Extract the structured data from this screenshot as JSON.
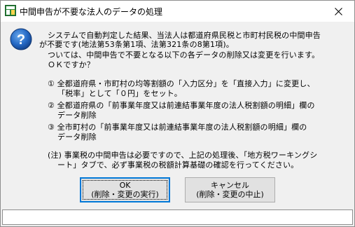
{
  "window": {
    "title": "中間申告が不要な法人のデータの処理"
  },
  "icons": {
    "app": "app-icon",
    "dialog": "question-icon",
    "close": "close-icon"
  },
  "message": {
    "lines": [
      "システムで自動判定した結果、当法人は都道府県民税と市町村民税の中間申告",
      "が不要です(地法第53条第1項、法第321条の8第1項)。",
      "ついては、中間申告で不要となる以下の各データの削除又は変更を行います。",
      "ＯＫですか？",
      "①  全都道府県・市町村の均等割額の「入力区分」を「直接入力」に変更し、",
      "「税率」として「０円」をセット。",
      "②  全都道府県の「前事業年度又は前連結事業年度の法人税割額の明細」欄の",
      "データ削除",
      "③  全市町村の「前事業年度又は前連結事業年度の法人税割額の明細」欄の",
      "データ削除",
      "(注)  事業税の中間申告は必要ですので、上記の処理後、「地方税ワーキングシ",
      "ート」タブで、必ず事業税の税額計算基礎の確認を行ってください。"
    ]
  },
  "buttons": {
    "ok": {
      "line1": "OK",
      "line2": "(削除・変更の実行)"
    },
    "cancel": {
      "line1": "キャンセル",
      "line2": "(削除・変更の中止)"
    }
  },
  "status": {
    "text": ""
  },
  "colors": {
    "dialog_bg": "#f0f0f0",
    "title_bg": "#ffffff",
    "accent_focus": "#0078d7",
    "question_icon": "#1c5fb0"
  }
}
